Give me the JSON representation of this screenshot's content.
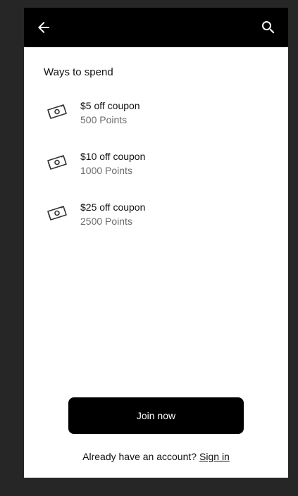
{
  "header": {
    "back_icon": "arrow-back-icon",
    "search_icon": "search-icon"
  },
  "section": {
    "title": "Ways to spend"
  },
  "rewards": [
    {
      "title": "$5 off coupon",
      "points": "500 Points",
      "icon": "money-icon"
    },
    {
      "title": "$10 off coupon",
      "points": "1000 Points",
      "icon": "money-icon"
    },
    {
      "title": "$25 off coupon",
      "points": "2500 Points",
      "icon": "money-icon"
    }
  ],
  "footer": {
    "join_label": "Join now",
    "account_prompt": "Already have an account?",
    "signin_label": "Sign in"
  },
  "colors": {
    "background": "#262626",
    "appbar": "#000000",
    "surface": "#ffffff",
    "primary_button": "#000000",
    "secondary_text": "#6b6b6b"
  }
}
